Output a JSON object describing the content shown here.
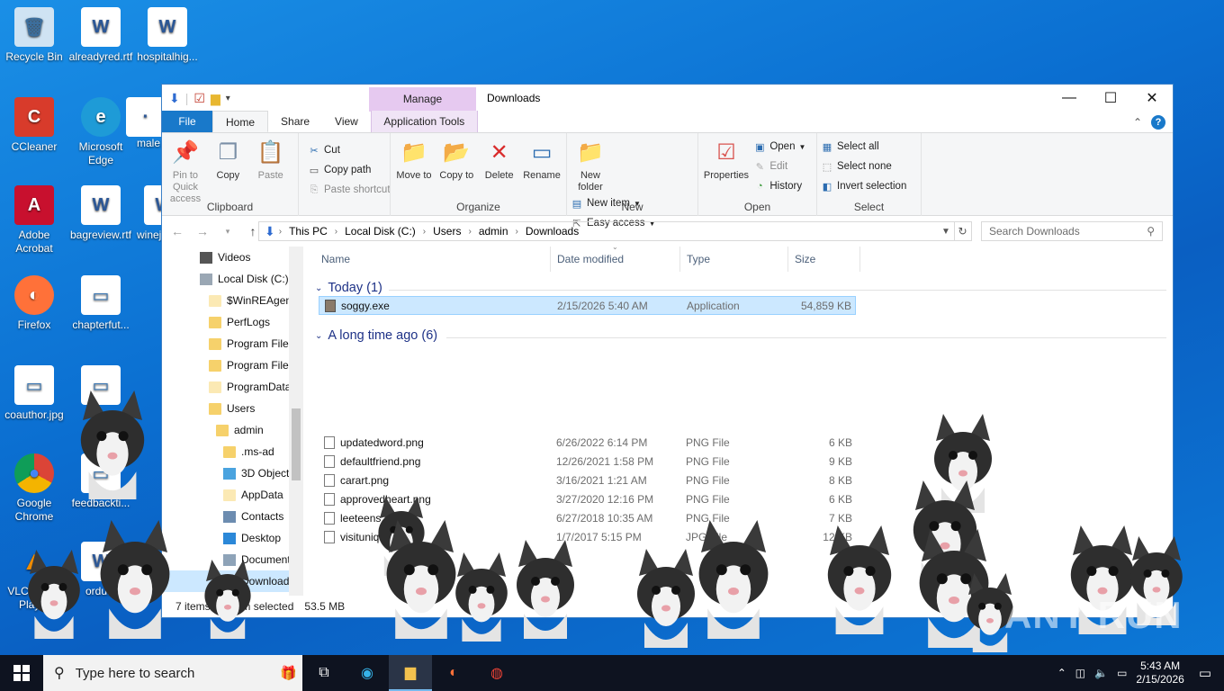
{
  "desktop": {
    "icons": [
      {
        "label": "Recycle Bin"
      },
      {
        "label": "alreadyred.rtf"
      },
      {
        "label": "hospitalhig..."
      },
      {
        "label": "CCleaner"
      },
      {
        "label": "Microsoft Edge"
      },
      {
        "label": "male..."
      },
      {
        "label": "Adobe Acrobat"
      },
      {
        "label": "bagreview.rtf"
      },
      {
        "label": "winej..."
      },
      {
        "label": "Firefox"
      },
      {
        "label": "chapterfut..."
      },
      {
        "label": "coauthor.jpg"
      },
      {
        "label": "Google Chrome"
      },
      {
        "label": "feedbackti..."
      },
      {
        "label": "VLC Media Player"
      },
      {
        "label": "ordu..."
      }
    ]
  },
  "window": {
    "title": "Downloads",
    "contextual_tab": "Manage",
    "tabs": [
      "File",
      "Home",
      "Share",
      "View",
      "Application Tools"
    ],
    "controls": {
      "minimize": "—",
      "maximize": "☐",
      "close": "✕"
    }
  },
  "ribbon": {
    "clipboard": {
      "name": "Clipboard",
      "pin": "Pin to Quick access",
      "copy": "Copy",
      "paste": "Paste",
      "cut": "Cut",
      "copy_path": "Copy path",
      "paste_shortcut": "Paste shortcut"
    },
    "organize": {
      "name": "Organize",
      "move_to": "Move to",
      "copy_to": "Copy to",
      "delete": "Delete",
      "rename": "Rename"
    },
    "new": {
      "name": "New",
      "new_folder": "New folder",
      "new_item": "New item",
      "easy_access": "Easy access"
    },
    "open": {
      "name": "Open",
      "properties": "Properties",
      "open": "Open",
      "edit": "Edit",
      "history": "History"
    },
    "select": {
      "name": "Select",
      "select_all": "Select all",
      "select_none": "Select none",
      "invert": "Invert selection"
    }
  },
  "address": {
    "crumbs": [
      "This PC",
      "Local Disk (C:)",
      "Users",
      "admin",
      "Downloads"
    ],
    "search_placeholder": "Search Downloads"
  },
  "nav": {
    "items": [
      {
        "label": "Videos"
      },
      {
        "label": "Local Disk (C:)"
      },
      {
        "label": "$WinREAgent"
      },
      {
        "label": "PerfLogs"
      },
      {
        "label": "Program Files"
      },
      {
        "label": "Program Files"
      },
      {
        "label": "ProgramData"
      },
      {
        "label": "Users"
      },
      {
        "label": "admin"
      },
      {
        "label": ".ms-ad"
      },
      {
        "label": "3D Objects"
      },
      {
        "label": "AppData"
      },
      {
        "label": "Contacts"
      },
      {
        "label": "Desktop"
      },
      {
        "label": "Documents"
      },
      {
        "label": "Downloads"
      }
    ]
  },
  "files": {
    "columns": [
      "Name",
      "Date modified",
      "Type",
      "Size"
    ],
    "groups": [
      {
        "title": "Today (1)",
        "rows": [
          {
            "name": "soggy.exe",
            "date": "2/15/2026 5:40 AM",
            "type": "Application",
            "size": "54,859 KB"
          }
        ]
      },
      {
        "title": "A long time ago (6)",
        "rows": [
          {
            "name": "updatedword.png",
            "date": "6/26/2022 6:14 PM",
            "type": "PNG File",
            "size": "6 KB"
          },
          {
            "name": "defaultfriend.png",
            "date": "12/26/2021 1:58 PM",
            "type": "PNG File",
            "size": "9 KB"
          },
          {
            "name": "carart.png",
            "date": "3/16/2021 1:21 AM",
            "type": "PNG File",
            "size": "8 KB"
          },
          {
            "name": "approvedheart.png",
            "date": "3/27/2020 12:16 PM",
            "type": "PNG File",
            "size": "6 KB"
          },
          {
            "name": "leeteens.png",
            "date": "6/27/2018 10:35 AM",
            "type": "PNG File",
            "size": "7 KB"
          },
          {
            "name": "visitunique.jpg",
            "date": "1/7/2017 5:15 PM",
            "type": "JPG File",
            "size": "12 KB"
          }
        ]
      }
    ]
  },
  "status": {
    "items": "7 items",
    "selected": "1 item selected",
    "size": "53.5 MB"
  },
  "taskbar": {
    "search_placeholder": "Type here to search",
    "time": "5:43 AM",
    "date": "2/15/2026"
  },
  "watermark": "ANY RUN"
}
